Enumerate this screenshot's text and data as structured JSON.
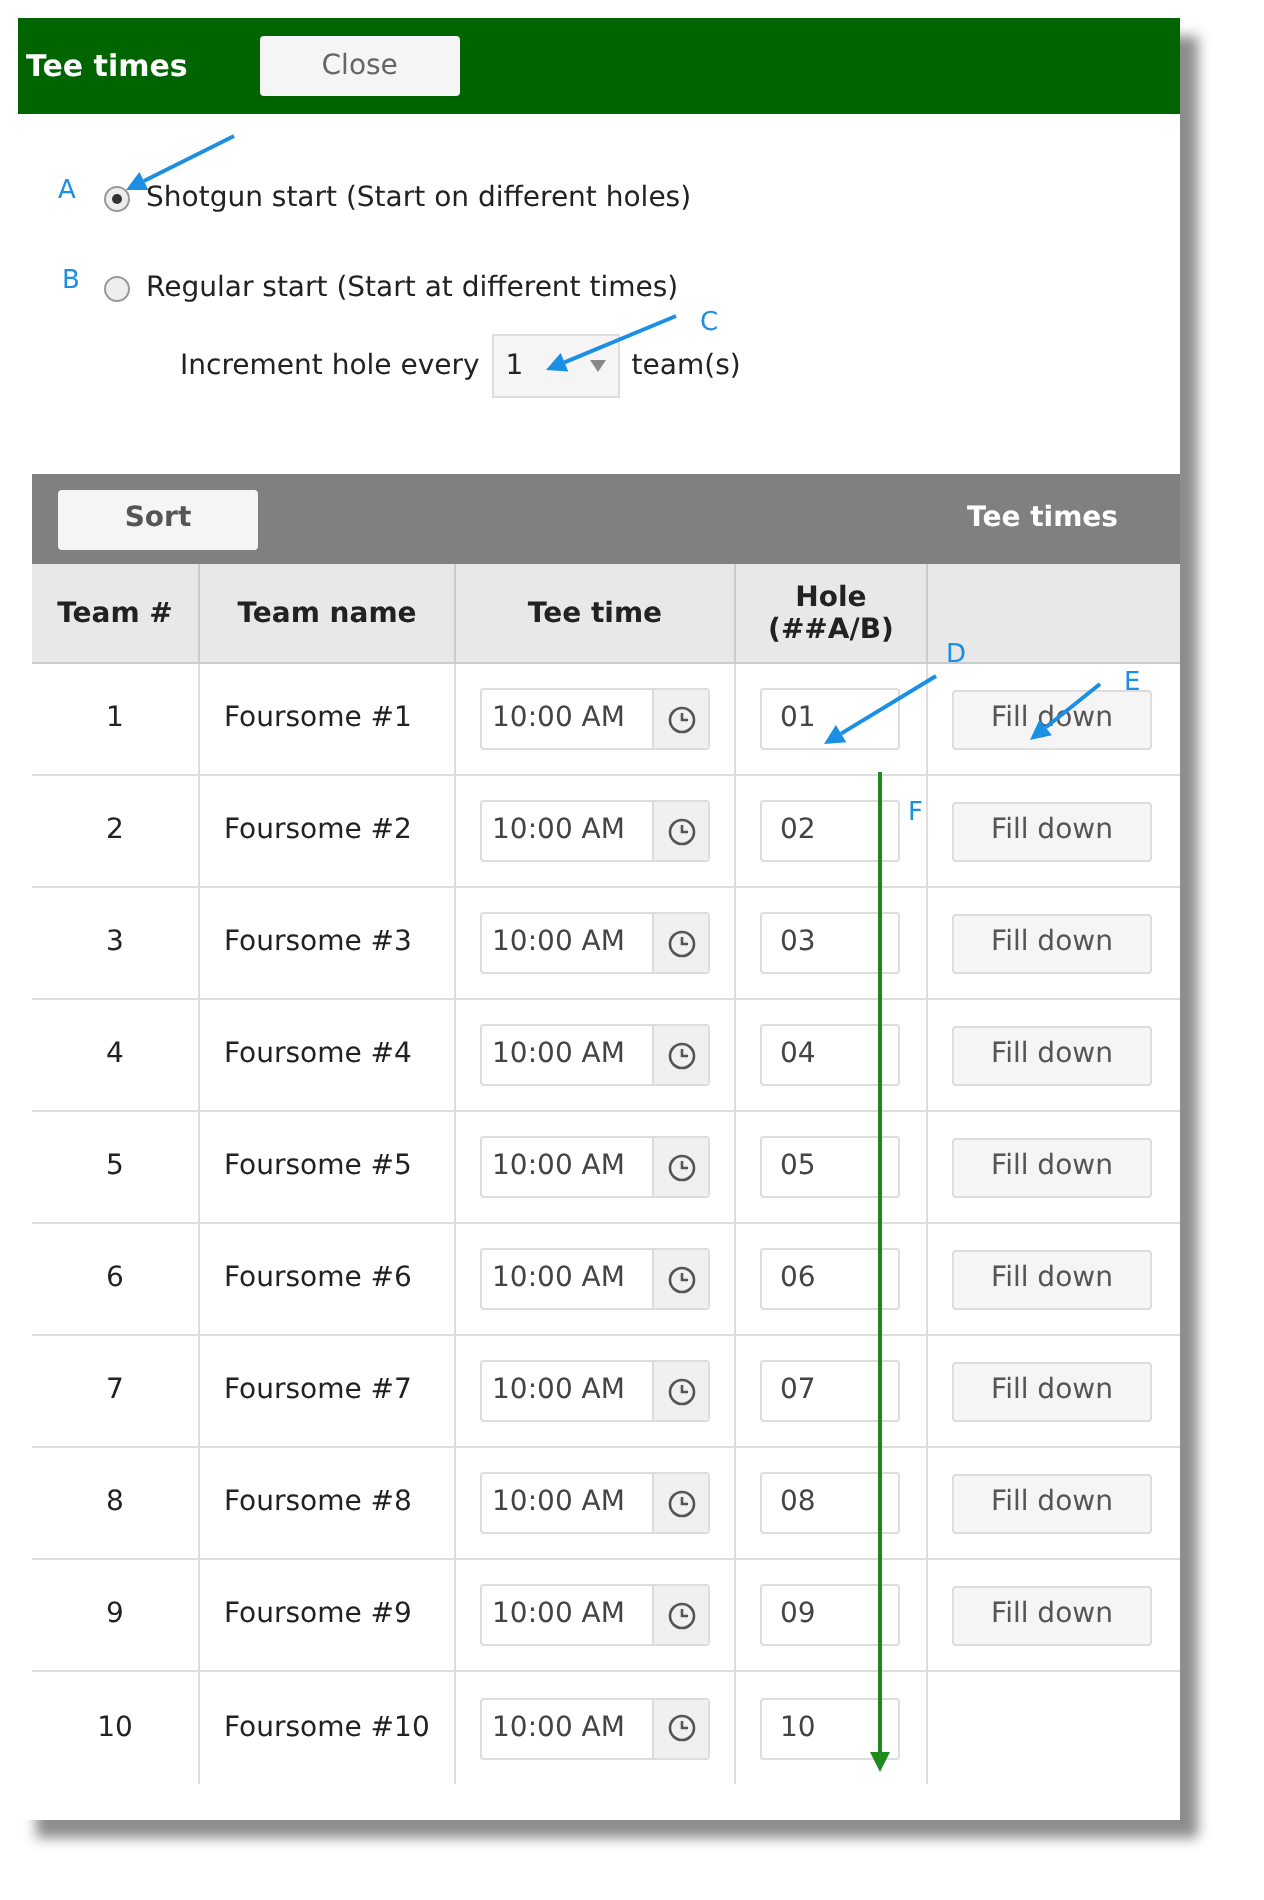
{
  "window": {
    "title": "Tee times",
    "close_button": "Close"
  },
  "start_options": [
    {
      "label": "Shotgun start (Start on different holes)",
      "selected": true
    },
    {
      "label": "Regular start (Start at different times)",
      "selected": false
    }
  ],
  "increment": {
    "label": "Increment hole every",
    "value": "1",
    "suffix": "team(s)"
  },
  "toolbar": {
    "sort_button": "Sort",
    "title": "Tee times"
  },
  "table": {
    "columns": [
      "Team #",
      "Team name",
      "Tee time",
      "Hole\n(##A/B)",
      ""
    ],
    "rows": [
      {
        "team": "1",
        "name": "Foursome #1",
        "tee_time": "10:00 AM",
        "hole": "01",
        "fill_down": "Fill down"
      },
      {
        "team": "2",
        "name": "Foursome #2",
        "tee_time": "10:00 AM",
        "hole": "02",
        "fill_down": "Fill down"
      },
      {
        "team": "3",
        "name": "Foursome #3",
        "tee_time": "10:00 AM",
        "hole": "03",
        "fill_down": "Fill down"
      },
      {
        "team": "4",
        "name": "Foursome #4",
        "tee_time": "10:00 AM",
        "hole": "04",
        "fill_down": "Fill down"
      },
      {
        "team": "5",
        "name": "Foursome #5",
        "tee_time": "10:00 AM",
        "hole": "05",
        "fill_down": "Fill down"
      },
      {
        "team": "6",
        "name": "Foursome #6",
        "tee_time": "10:00 AM",
        "hole": "06",
        "fill_down": "Fill down"
      },
      {
        "team": "7",
        "name": "Foursome #7",
        "tee_time": "10:00 AM",
        "hole": "07",
        "fill_down": "Fill down"
      },
      {
        "team": "8",
        "name": "Foursome #8",
        "tee_time": "10:00 AM",
        "hole": "08",
        "fill_down": "Fill down"
      },
      {
        "team": "9",
        "name": "Foursome #9",
        "tee_time": "10:00 AM",
        "hole": "09",
        "fill_down": "Fill down"
      },
      {
        "team": "10",
        "name": "Foursome #10",
        "tee_time": "10:00 AM",
        "hole": "10"
      }
    ]
  },
  "callouts": [
    {
      "label": "A"
    },
    {
      "label": "B"
    },
    {
      "label": "C"
    },
    {
      "label": "D"
    },
    {
      "label": "E"
    },
    {
      "label": "F"
    }
  ]
}
